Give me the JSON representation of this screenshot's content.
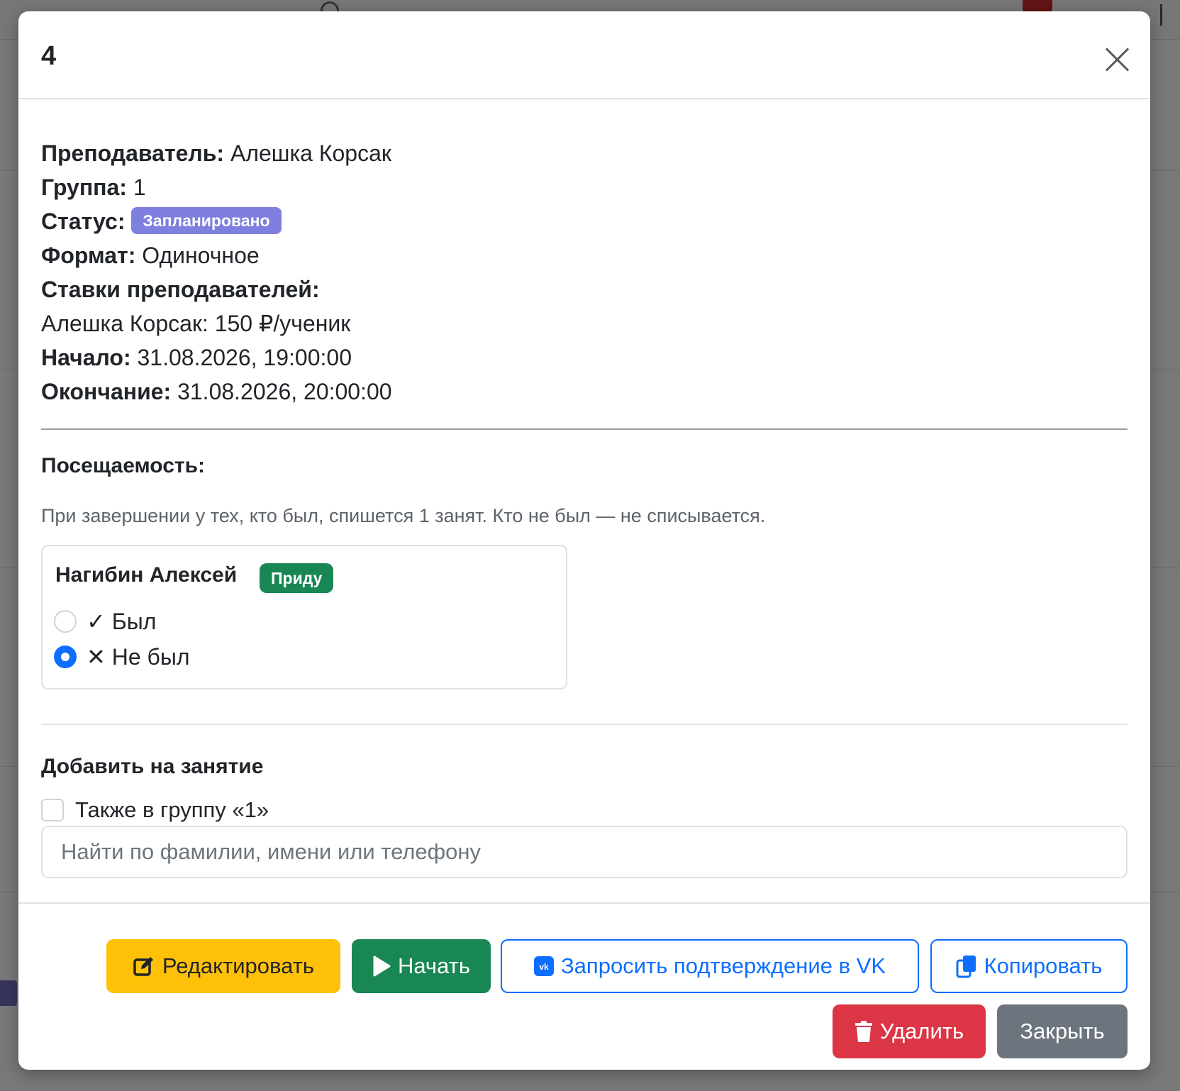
{
  "modal": {
    "title": "4",
    "info": {
      "teacher_label": "Преподаватель:",
      "teacher_value": "Алешка Корсак",
      "group_label": "Группа:",
      "group_value": "1",
      "status_label": "Статус:",
      "status_value": "Запланировано",
      "format_label": "Формат:",
      "format_value": "Одиночное",
      "rates_label": "Ставки преподавателей:",
      "rates_value": "Алешка Корсак: 150 ₽/ученик",
      "start_label": "Начало:",
      "start_value": "31.08.2026, 19:00:00",
      "end_label": "Окончание:",
      "end_value": "31.08.2026, 20:00:00"
    },
    "attendance": {
      "title": "Посещаемость:",
      "note": "При завершении у тех, кто был, спишется 1 занят. Кто не был — не списывается.",
      "student": {
        "name": "Нагибин Алексей",
        "badge": "Приду",
        "option_present": "✓ Был",
        "option_absent": "✕ Не был",
        "selected": "absent"
      }
    },
    "add": {
      "title": "Добавить на занятие",
      "also_group_label": "Также в группу «1»",
      "also_group_checked": false,
      "search_placeholder": "Найти по фамилии, имени или телефону",
      "search_value": ""
    },
    "footer": {
      "edit_label": "Редактировать",
      "start_label": "Начать",
      "vk_label": "Запросить подтверждение в VK",
      "copy_label": "Копировать",
      "delete_label": "Удалить",
      "close_label": "Закрыть"
    }
  },
  "colors": {
    "status_badge": "#7f7fe0",
    "green_badge": "#198754",
    "primary": "#0d6efd",
    "warning": "#ffc107",
    "danger": "#dc3545",
    "secondary": "#6c757d"
  },
  "icons": {
    "close": "close-icon",
    "edit": "edit-icon",
    "start": "play-icon",
    "vk": "vk-icon",
    "copy": "copy-icon",
    "delete": "trash-icon"
  }
}
